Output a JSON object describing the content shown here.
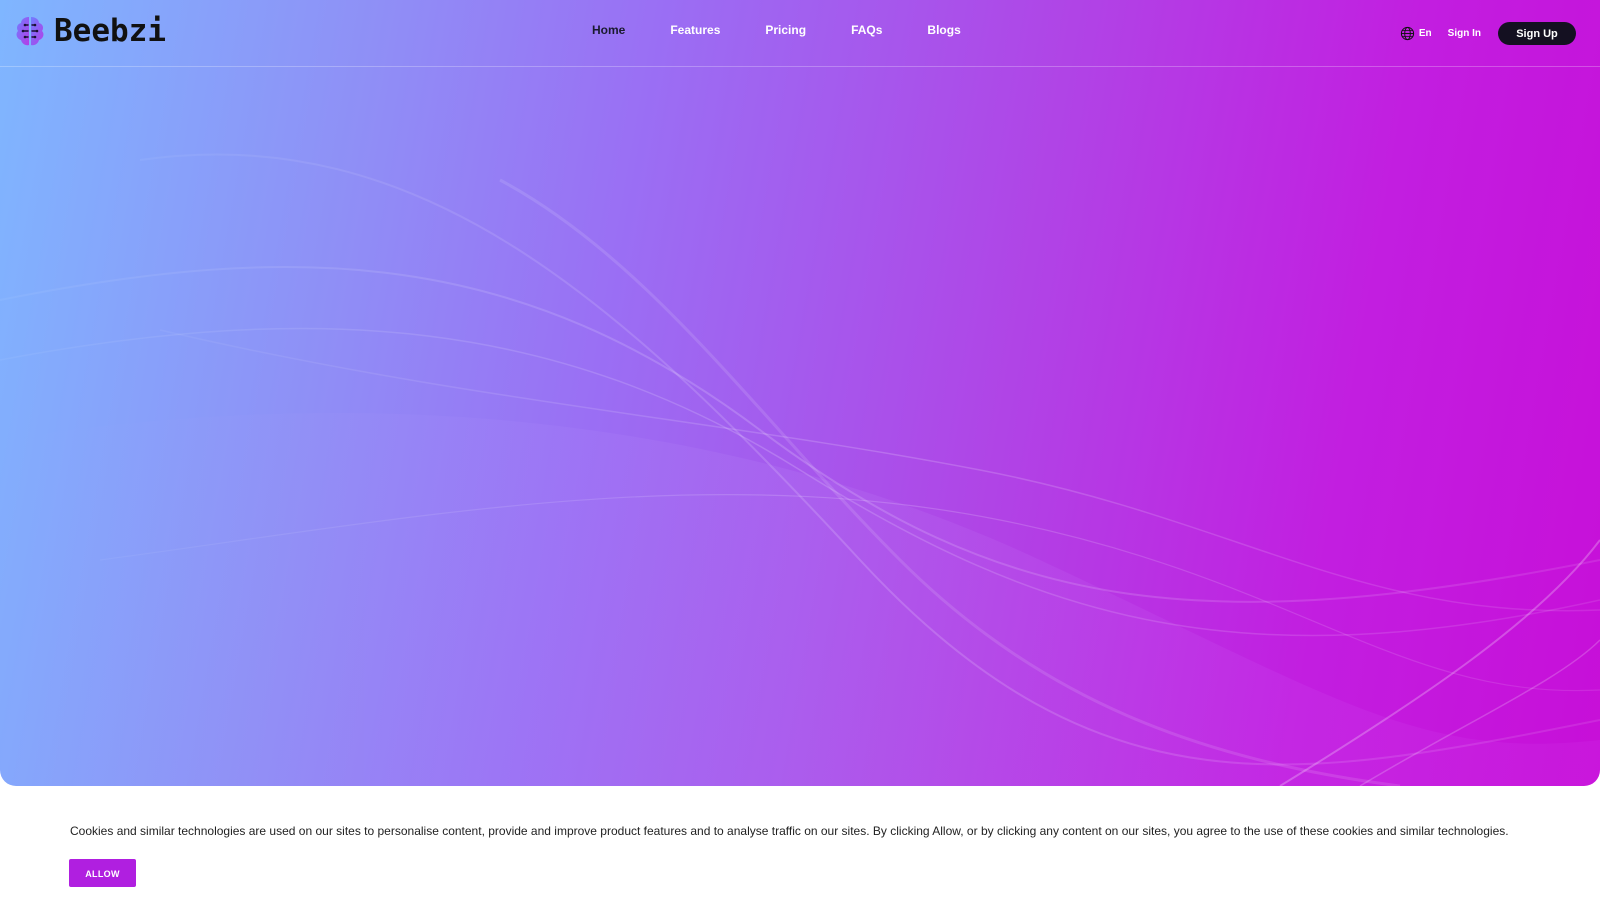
{
  "brand": {
    "name": "Beebzi",
    "logo_icon": "brain-icon"
  },
  "nav": {
    "items": [
      {
        "label": "Home",
        "active": true
      },
      {
        "label": "Features",
        "active": false
      },
      {
        "label": "Pricing",
        "active": false
      },
      {
        "label": "FAQs",
        "active": false
      },
      {
        "label": "Blogs",
        "active": false
      }
    ],
    "language_label": "En",
    "language_icon": "globe-icon",
    "sign_in_label": "Sign In",
    "sign_up_label": "Sign Up"
  },
  "cookie_banner": {
    "text": "Cookies and similar technologies are used on our sites to personalise content, provide and improve product features and to analyse traffic on our sites. By clicking Allow, or by clicking any content on our sites, you agree to the use of these cookies and similar technologies.",
    "allow_label": "ALLOW"
  },
  "colors": {
    "gradient_start": "#7fb6ff",
    "gradient_mid": "#9a6ff4",
    "gradient_end": "#c70fd8",
    "signup_bg": "#141021",
    "allow_bg": "#b01fe0"
  }
}
